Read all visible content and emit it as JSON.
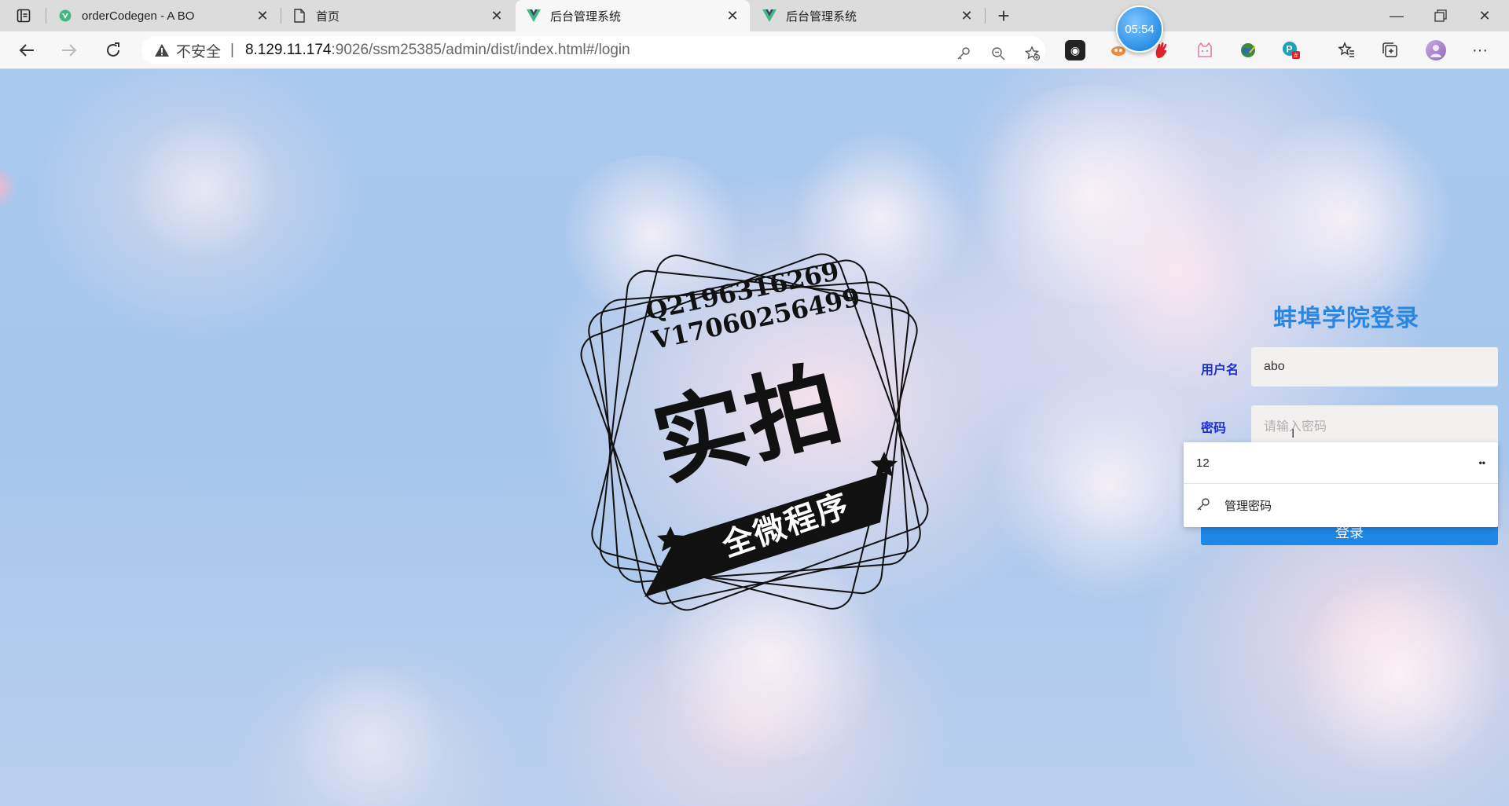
{
  "browser": {
    "tabs": [
      {
        "title": "orderCodegen - A BO",
        "icon": "vue-icon"
      },
      {
        "title": "首页",
        "icon": "page-icon"
      },
      {
        "title": "后台管理系统",
        "icon": "vue-icon",
        "active": true
      },
      {
        "title": "后台管理系统",
        "icon": "vue-icon"
      }
    ],
    "clock": "05:54",
    "address": {
      "security_label": "不安全",
      "separator": "|",
      "host": "8.129.11.174",
      "path": ":9026/ssm25385/admin/dist/index.html#/login"
    }
  },
  "watermark": {
    "line1": "Q2196316269",
    "line2": "V17060256499",
    "headline": "实拍",
    "banner": "全微程序"
  },
  "login": {
    "title": "蚌埠学院登录",
    "username_label": "用户名",
    "username_value": "abo",
    "password_label": "密码",
    "password_placeholder": "请输入密码",
    "submit_label": "登录"
  },
  "autofill": {
    "suggestion": "12",
    "more_label": "••",
    "manage_label": "管理密码"
  },
  "colors": {
    "accent": "#2a86e0",
    "button": "#1f87e5",
    "label": "#1a2fd0"
  }
}
